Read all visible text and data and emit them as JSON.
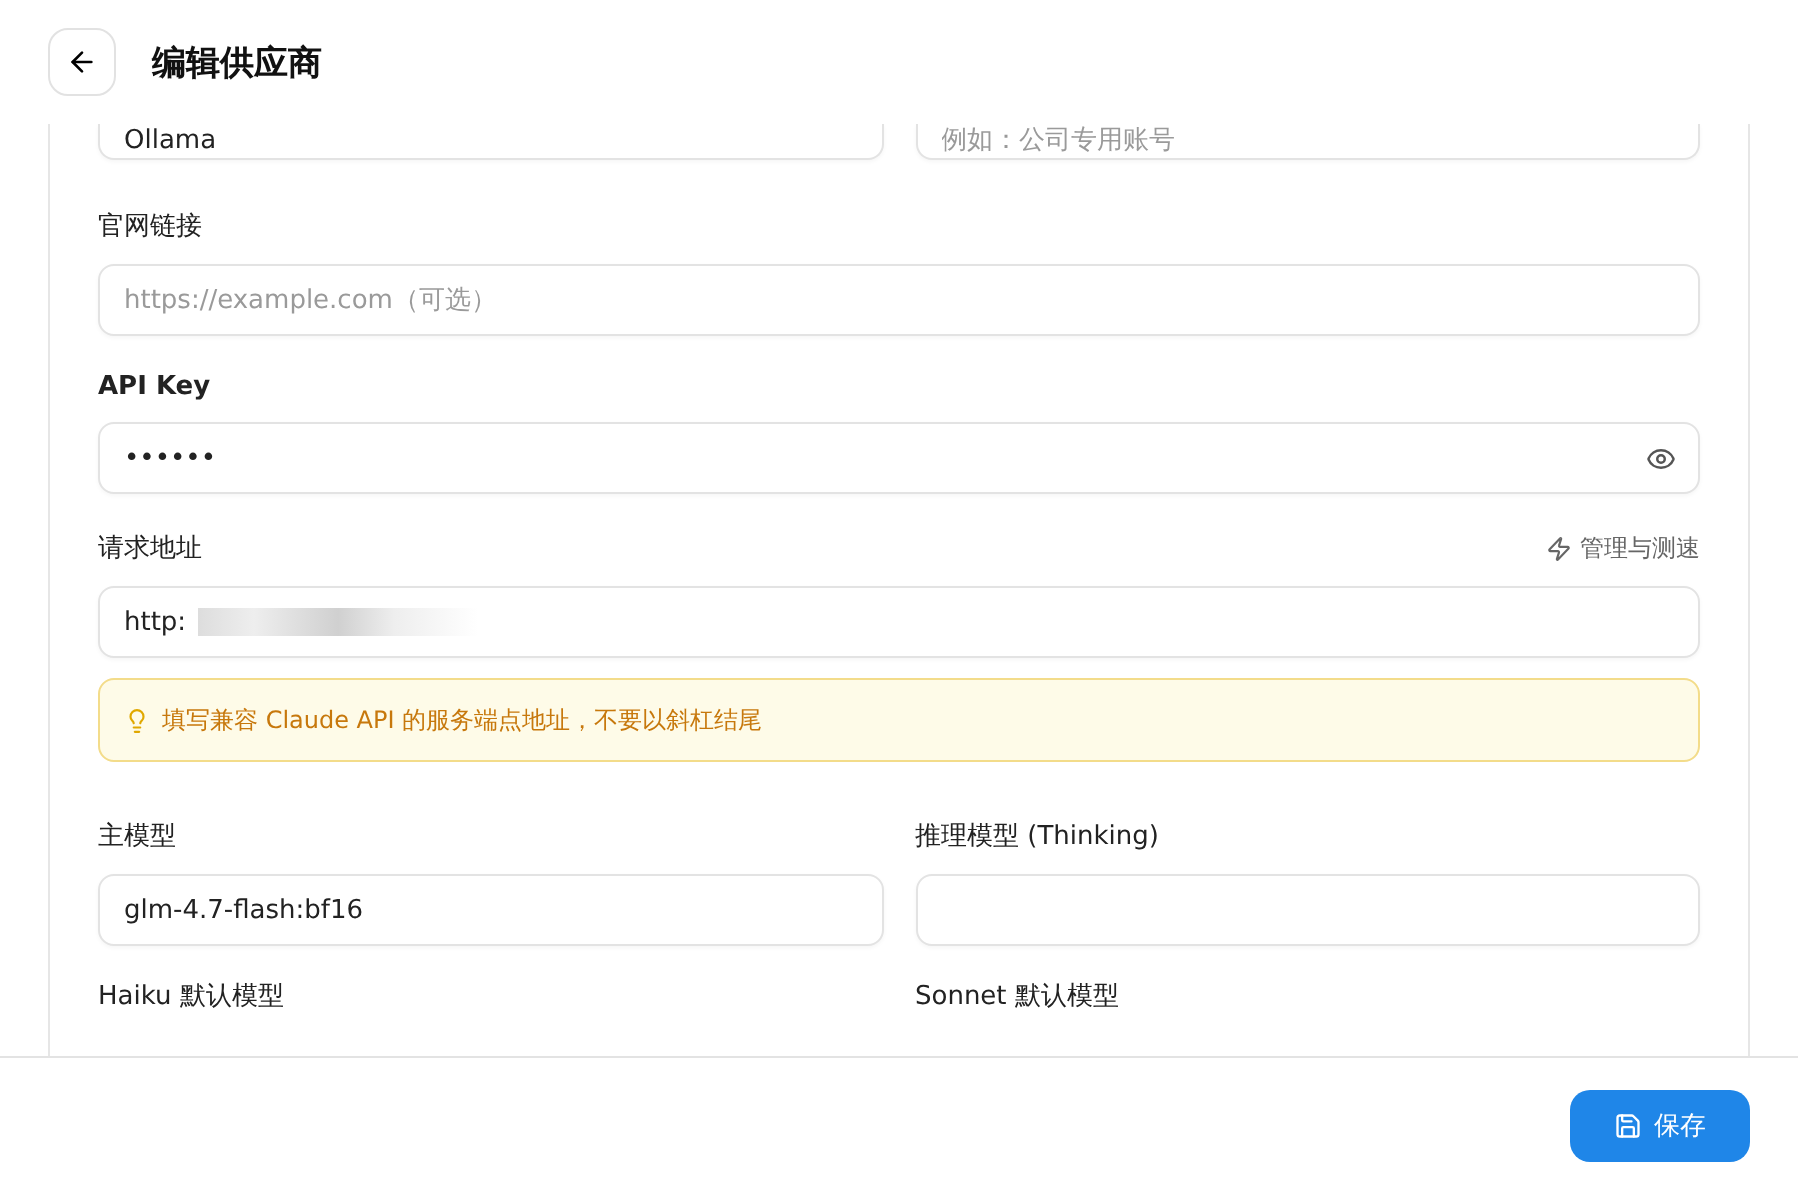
{
  "header": {
    "title": "编辑供应商"
  },
  "top_fields": [
    {
      "value": "Ollama"
    },
    {
      "placeholder": "例如：公司专用账号"
    }
  ],
  "website": {
    "label": "官网链接",
    "placeholder": "https://example.com（可选）"
  },
  "api_key": {
    "label": "API Key",
    "value": "••••••"
  },
  "endpoint": {
    "label": "请求地址",
    "action": "管理与测速",
    "value": "http:",
    "hint": "填写兼容 Claude API 的服务端点地址，不要以斜杠结尾"
  },
  "models": [
    {
      "label": "主模型",
      "value": "glm-4.7-flash:bf16"
    },
    {
      "label": "推理模型 (Thinking)"
    }
  ],
  "model_labels": [
    "Haiku 默认模型",
    "Sonnet 默认模型"
  ],
  "footer": {
    "save": "保存"
  }
}
